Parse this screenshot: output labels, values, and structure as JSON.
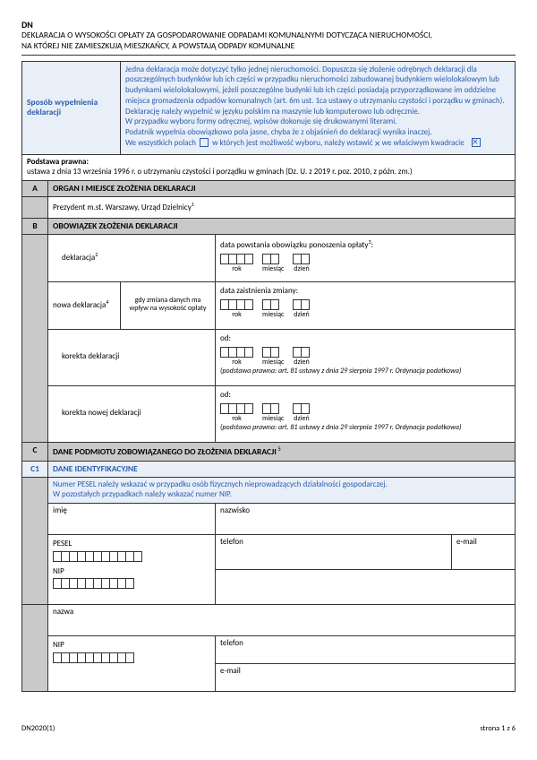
{
  "header": {
    "code": "DN",
    "title_line1": "DEKLARACJA O WYSOKOŚCI OPŁATY ZA GOSPODAROWANIE ODPADAMI KOMUNALNYMI DOTYCZĄCA NIERUCHOMOŚCI,",
    "title_line2": "NA KTÓREJ NIE ZAMIESZKUJĄ MIESZKAŃCY, A POWSTAJĄ ODPADY KOMUNALNE"
  },
  "sposob": {
    "label": "Sposób wypełnienia deklaracji",
    "p1": "Jedna deklaracja może dotyczyć tylko jednej nieruchomości. Dopuszcza się złożenie odrębnych deklaracji dla poszczególnych budynków lub ich części w przypadku nieruchomości zabudowanej budynkiem wielolokalowym lub budynkami wielolokalowymi, jeżeli poszczególne budynki lub ich części posiadają przyporządkowane im oddzielne miejsca gromadzenia odpadów komunalnych (art. 6m ust. 1ca ustawy o utrzymaniu czystości i porządku w gminach).",
    "p2": "Deklarację należy wypełnić w języku polskim na maszynie lub komputerowo lub odręcznie.",
    "p3": "W przypadku wyboru formy odręcznej, wpisów dokonuje się drukowanymi literami.",
    "p4": "Podatnik wypełnia obowiązkowo pola jasne, chyba że z objaśnień do deklaracji wynika inaczej.",
    "p5a": "We wszystkich polach",
    "p5b": " w których jest możliwość wyboru, należy wstawić ",
    "p5c": " we właściwym kwadracie"
  },
  "podstawa": {
    "label": "Podstawa prawna:",
    "text": "ustawa z dnia 13 września 1996 r. o utrzymaniu czystości i porządku w gminach (Dz. U. z 2019 r. poz. 2010, z późn. zm.)"
  },
  "sectionA": {
    "letter": "A",
    "title": "ORGAN I MIEJSCE ZŁOŻENIA DEKLARACJI",
    "content": "Prezydent m.st. Warszawy, Urząd Dzielnicy"
  },
  "sectionB": {
    "letter": "B",
    "title": "OBOWIĄZEK ZŁOŻENIA DEKLARACJI",
    "rows": {
      "r1": {
        "left": "deklaracja",
        "right_label": "data powstania obowiązku ponoszenia opłaty"
      },
      "r2": {
        "left": "nowa deklaracja",
        "sub": "gdy zmiana danych ma wpływ na wysokość opłaty",
        "right_label": "data zaistnienia zmiany:"
      },
      "r3": {
        "left": "korekta deklaracji",
        "right_label": "od:",
        "note": "(podstawa prawna: art. 81 ustawy z dnia 29 sierpnia 1997 r. Ordynacja podatkowa)"
      },
      "r4": {
        "left": "korekta nowej deklaracji",
        "right_label": "od:",
        "note": "(podstawa prawna: art. 81 ustawy z dnia 29 sierpnia 1997 r. Ordynacja podatkowa)"
      }
    },
    "date_labels": {
      "rok": "rok",
      "miesiac": "miesiąc",
      "dzien": "dzień"
    }
  },
  "sectionC": {
    "letter": "C",
    "title": "DANE PODMIOTU ZOBOWIĄZANEGO DO ZŁOŻENIA DEKLARACJI",
    "c1": "C1",
    "c1_title": "DANE IDENTYFIKACYJNE",
    "note1": "Numer PESEL należy wskazać w przypadku osób fizycznych nieprowadzących działalności gospodarczej.",
    "note2": "W pozostałych przypadkach należy wskazać numer NIP.",
    "fields": {
      "imie": "imię",
      "nazwisko": "nazwisko",
      "pesel": "PESEL",
      "telefon": "telefon",
      "email": "e-mail",
      "nip": "NIP",
      "nazwa": "nazwa"
    }
  },
  "footer": {
    "left": "DN2020(1)",
    "right": "strona 1 z 6"
  }
}
